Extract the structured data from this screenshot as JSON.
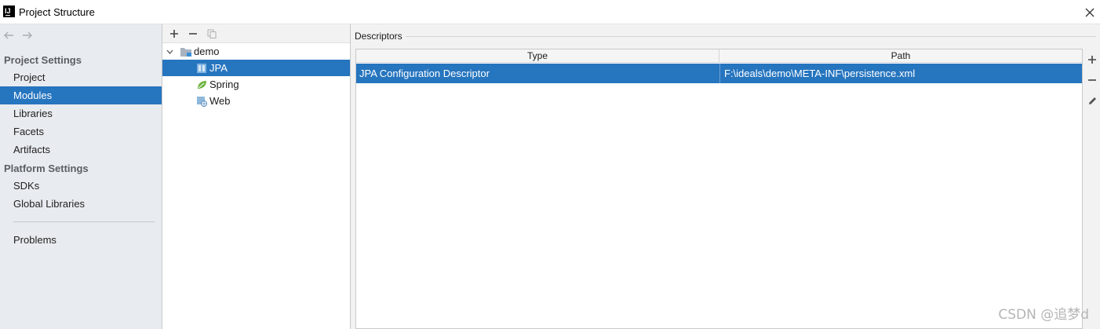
{
  "window": {
    "title": "Project Structure",
    "app_icon_text": "IJ"
  },
  "sidebar": {
    "sections": [
      {
        "header": "Project Settings",
        "items": [
          "Project",
          "Modules",
          "Libraries",
          "Facets",
          "Artifacts"
        ]
      },
      {
        "header": "Platform Settings",
        "items": [
          "SDKs",
          "Global Libraries"
        ]
      }
    ],
    "selected_item": "Modules",
    "problems_label": "Problems"
  },
  "tree": {
    "root": {
      "label": "demo",
      "expanded": true
    },
    "children": [
      {
        "label": "JPA",
        "icon": "jpa-facet-icon",
        "selected": true
      },
      {
        "label": "Spring",
        "icon": "spring-leaf-icon",
        "selected": false
      },
      {
        "label": "Web",
        "icon": "web-facet-icon",
        "selected": false
      }
    ]
  },
  "descriptors": {
    "group_label": "Descriptors",
    "columns": [
      "Type",
      "Path"
    ],
    "rows": [
      {
        "type": "JPA Configuration Descriptor",
        "path": "F:\\ideals\\demo\\META-INF\\persistence.xml",
        "selected": true
      }
    ]
  },
  "watermark": "CSDN @追梦d",
  "colors": {
    "selection": "#2675bf",
    "sidebar_bg": "#e8ebef",
    "panel_bg": "#f2f2f2"
  }
}
